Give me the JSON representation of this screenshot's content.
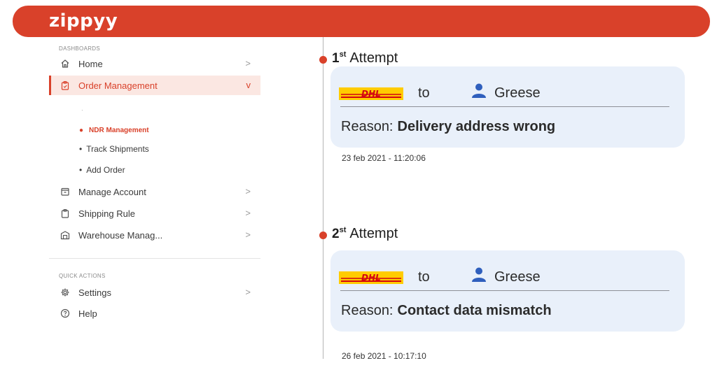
{
  "brand": {
    "name": "zippyy",
    "color": "#d9412a"
  },
  "sidebar": {
    "dashboards_label": "DASHBOARDS",
    "quick_actions_label": "QUICK ACTIONS",
    "items": [
      {
        "label": "Home",
        "icon": "home-icon",
        "chevron": ">"
      },
      {
        "label": "Order Management",
        "icon": "clipboard-icon",
        "chevron": "v",
        "active": true
      },
      {
        "label": "Manage Account",
        "icon": "account-box-icon",
        "chevron": ">"
      },
      {
        "label": "Shipping Rule",
        "icon": "clipboard-rule-icon",
        "chevron": ">"
      },
      {
        "label": "Warehouse Manag...",
        "icon": "warehouse-icon",
        "chevron": ">"
      }
    ],
    "sub_items": [
      {
        "label": "NDR Management",
        "active": true
      },
      {
        "label": "Track Shipments"
      },
      {
        "label": "Add Order"
      }
    ],
    "quick_actions": [
      {
        "label": "Settings",
        "icon": "gear-icon",
        "chevron": ">"
      },
      {
        "label": "Help",
        "icon": "help-icon"
      }
    ]
  },
  "attempts": [
    {
      "number": "1",
      "suffix": "st",
      "label": "Attempt",
      "carrier": "DHL",
      "to": "to",
      "recipient": "Greese",
      "reason_label": "Reason:",
      "reason": "Delivery address wrong",
      "datetime": "23 feb 2021 - 11:20:06"
    },
    {
      "number": "2",
      "suffix": "st",
      "label": "Attempt",
      "carrier": "DHL",
      "to": "to",
      "recipient": "Greese",
      "reason_label": "Reason:",
      "reason": "Contact data mismatch",
      "datetime": "26 feb 2021 - 10:17:10"
    }
  ]
}
